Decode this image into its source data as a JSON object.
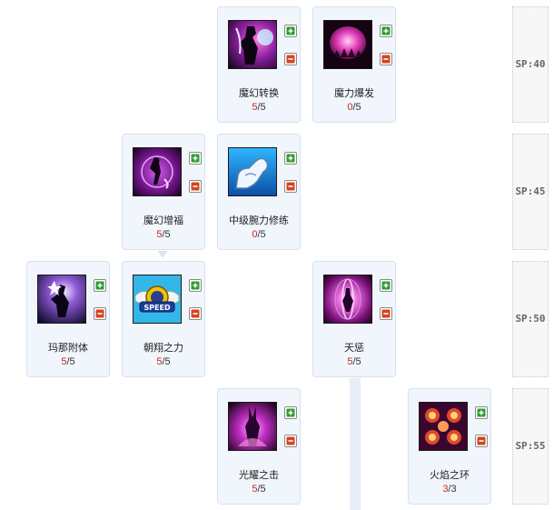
{
  "skills": [
    {
      "id": "huanmo",
      "name": "魔幻转换",
      "current": "5",
      "max": "5",
      "icon": "mage-transform-icon"
    },
    {
      "id": "baofa",
      "name": "魔力爆发",
      "current": "0",
      "max": "5",
      "icon": "mana-burst-icon"
    },
    {
      "id": "zengfu",
      "name": "魔幻增福",
      "current": "5",
      "max": "5",
      "icon": "mage-blessing-icon"
    },
    {
      "id": "wanli",
      "name": "中级腕力修练",
      "current": "0",
      "max": "5",
      "icon": "arm-muscle-icon"
    },
    {
      "id": "mana",
      "name": "玛那附体",
      "current": "5",
      "max": "5",
      "icon": "mana-possession-icon"
    },
    {
      "id": "speed",
      "name": "朝翔之力",
      "current": "5",
      "max": "5",
      "icon": "speed-wings-icon"
    },
    {
      "id": "tiancheng",
      "name": "天惩",
      "current": "5",
      "max": "5",
      "icon": "heaven-punish-icon"
    },
    {
      "id": "guangyao",
      "name": "光耀之击",
      "current": "5",
      "max": "5",
      "icon": "radiant-strike-icon"
    },
    {
      "id": "huoyan",
      "name": "火焰之环",
      "current": "3",
      "max": "3",
      "icon": "flame-ring-icon"
    }
  ],
  "speed_badge": "SPEED",
  "sp_labels": [
    "SP:40",
    "SP:45",
    "SP:50",
    "SP:55"
  ],
  "colors": {
    "current_level": "#c62828",
    "plus": "#2e9e2e",
    "minus": "#d8431f",
    "card_bg": "#f1f6fc"
  }
}
